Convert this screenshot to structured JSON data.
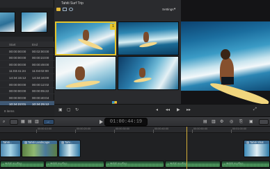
{
  "library": {
    "columns": [
      "Start",
      "End"
    ],
    "rows": [
      [
        "00:00:00:00",
        "00:02:00:00"
      ],
      [
        "00:00:00:00",
        "00:00:23:00"
      ],
      [
        "00:00:00:00",
        "00:00:49:00"
      ],
      [
        "11:03:41:24",
        "11:04:02:00"
      ],
      [
        "14:34:15:12",
        "14:34:16:00"
      ],
      [
        "00:00:00:00",
        "00:00:12:02"
      ],
      [
        "00:00:00:00",
        "00:00:05:22"
      ],
      [
        "00:00:00:00",
        "00:00:40:04"
      ],
      [
        "10:34:22:01",
        "10:34:25:12"
      ]
    ],
    "selected_row": 8,
    "count": "8 items"
  },
  "angle_viewer": {
    "title": "Tahiti Surf Trip",
    "settings_label": "Settings",
    "settings_chevron": "▾",
    "active_angle_badge": "1"
  },
  "toolbar": {
    "timecode": "01:00:44:19",
    "tools_left": [
      "⌕",
      "▦",
      "▤",
      "▥",
      "→"
    ],
    "tools_right": [
      "▤",
      "▥",
      "⚙",
      "◎",
      "⎘",
      "▣"
    ]
  },
  "timeline": {
    "ruler_labels": [
      "00:00:10:00",
      "00:00:20:00",
      "00:00:30:00",
      "00:00:40:00",
      "00:00:50:00",
      "00:01:00:00"
    ],
    "clips": [
      {
        "label": "Tahiti..."
      },
      {
        "label": "▨ Tahiti Landscape"
      },
      {
        "label": "▨ Tahi..."
      },
      {
        "label": "▨ Tahiti Shot"
      }
    ],
    "audio": [
      {
        "label": "▸ Tahiti Surfing"
      },
      {
        "label": "▸ Tahiti Surfing"
      },
      {
        "label": "▸ Tahiti Surfing"
      },
      {
        "label": "▸ Tahiti Surfing"
      },
      {
        "label": "▸ Tahiti Surfing"
      }
    ]
  }
}
